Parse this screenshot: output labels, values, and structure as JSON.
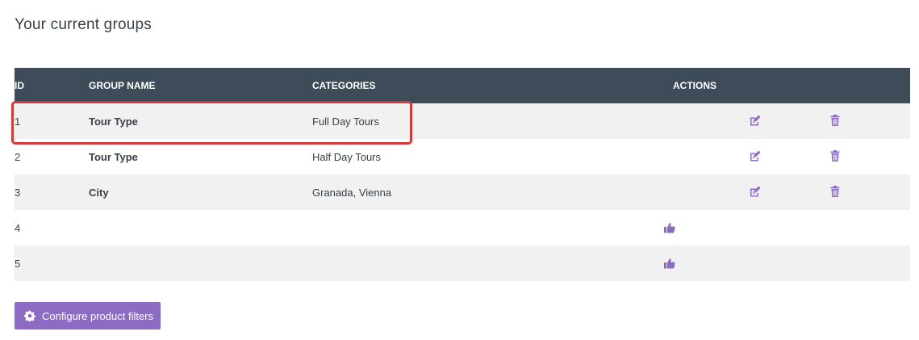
{
  "page": {
    "title": "Your current groups"
  },
  "table": {
    "headers": {
      "id": "ID",
      "group_name": "GROUP NAME",
      "categories": "CATEGORIES",
      "actions": "ACTIONS"
    },
    "rows": [
      {
        "id": "1",
        "group_name": "Tour Type",
        "categories": "Full Day Tours",
        "actions": [
          "edit-icon",
          "trash-icon"
        ]
      },
      {
        "id": "2",
        "group_name": "Tour Type",
        "categories": "Half Day Tours",
        "actions": [
          "edit-icon",
          "trash-icon"
        ]
      },
      {
        "id": "3",
        "group_name": "City",
        "categories": "Granada, Vienna",
        "actions": [
          "edit-icon",
          "trash-icon"
        ]
      },
      {
        "id": "4",
        "group_name": "",
        "categories": "",
        "actions": [
          "thumbs-up-icon"
        ]
      },
      {
        "id": "5",
        "group_name": "",
        "categories": "",
        "actions": [
          "thumbs-up-icon"
        ]
      }
    ]
  },
  "actions_bar": {
    "configure_label": "Configure product filters",
    "icon": "gear-icon"
  },
  "colors": {
    "header_bg": "#3e4c5a",
    "stripe_bg": "#f1f1f1",
    "icon_purple": "#8c6cc2",
    "button_bg": "#8c6cc2",
    "highlight_border": "#d9383b"
  }
}
